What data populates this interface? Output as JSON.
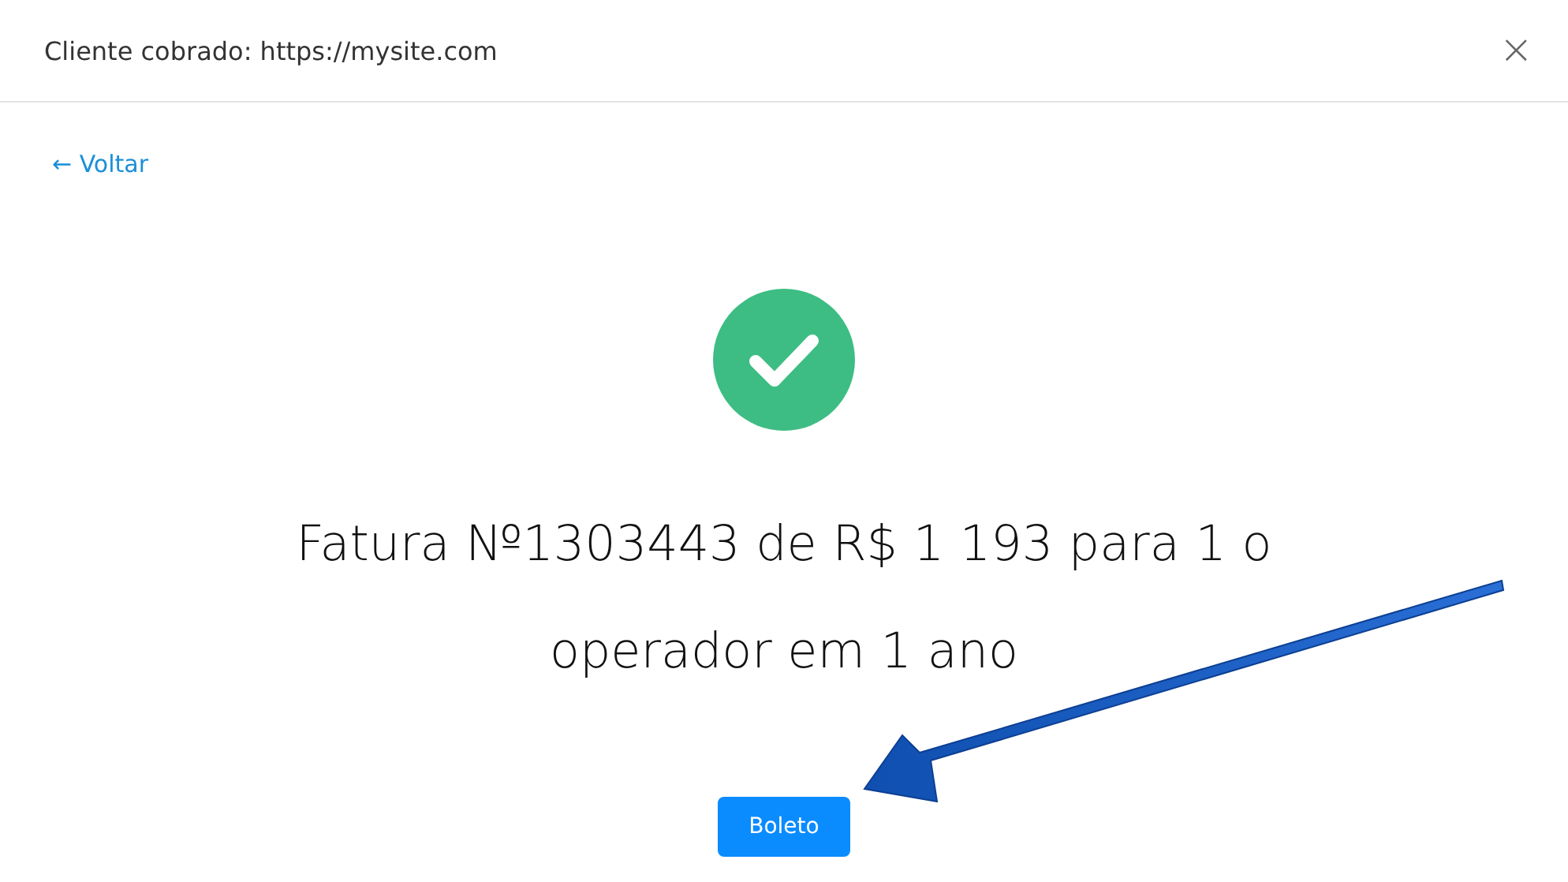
{
  "header": {
    "title": "Cliente cobrado: https://mysite.com",
    "close": "×"
  },
  "back_link": "← Voltar",
  "status": {
    "kind": "success"
  },
  "message": "Fatura №1303443 de R$ 1 193 para 1 o operador em 1 ano",
  "buttons": [
    "Boleto"
  ]
}
